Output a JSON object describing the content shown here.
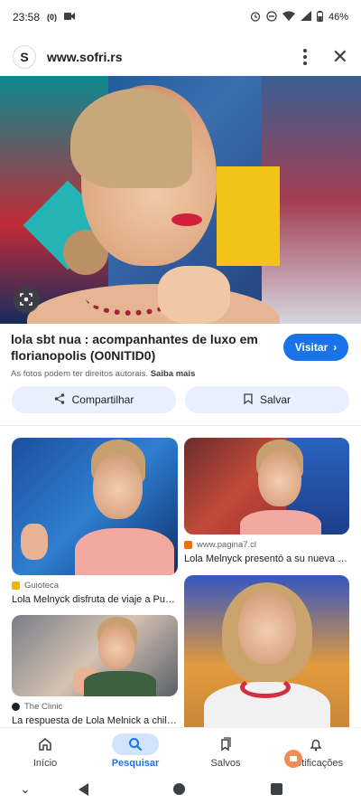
{
  "status_bar": {
    "time": "23:58",
    "battery": "46%",
    "notif_icons": [
      "(0)",
      "video-icon"
    ]
  },
  "url_bar": {
    "site_logo": "S",
    "url": "www.sofri.rs"
  },
  "hero": {
    "title": "lola sbt nua : acompanhantes de luxo em florianopolis (O0NITID0)",
    "copyright_note": "As fotos podem ter direitos autorais.",
    "learn_more": "Saiba mais",
    "visit_label": "Visitar"
  },
  "actions": {
    "share_label": "Compartilhar",
    "save_label": "Salvar"
  },
  "results": [
    {
      "source": "Guioteca",
      "title": "Lola Melnyck disfruta de viaje a Punta ...",
      "source_color": "#f4b400"
    },
    {
      "source": "www.pagina7.cl",
      "title": "Lola Melnyck presentó a su nueva pare...",
      "source_color": "#e8710a"
    },
    {
      "source": "The Clinic",
      "title": "La respuesta de Lola Melnick a chileno...",
      "source_color": "#202124"
    },
    {
      "source": "",
      "title": "",
      "source_color": ""
    }
  ],
  "bottom_nav": {
    "items": [
      {
        "label": "Início",
        "icon": "home-icon"
      },
      {
        "label": "Pesquisar",
        "icon": "search-icon"
      },
      {
        "label": "Salvos",
        "icon": "bookmarks-icon"
      },
      {
        "label": "Notificações",
        "icon": "bell-icon"
      }
    ],
    "active": "Pesquisar"
  },
  "colors": {
    "accent": "#1a73e8",
    "button_bg": "#e8f0fe"
  }
}
